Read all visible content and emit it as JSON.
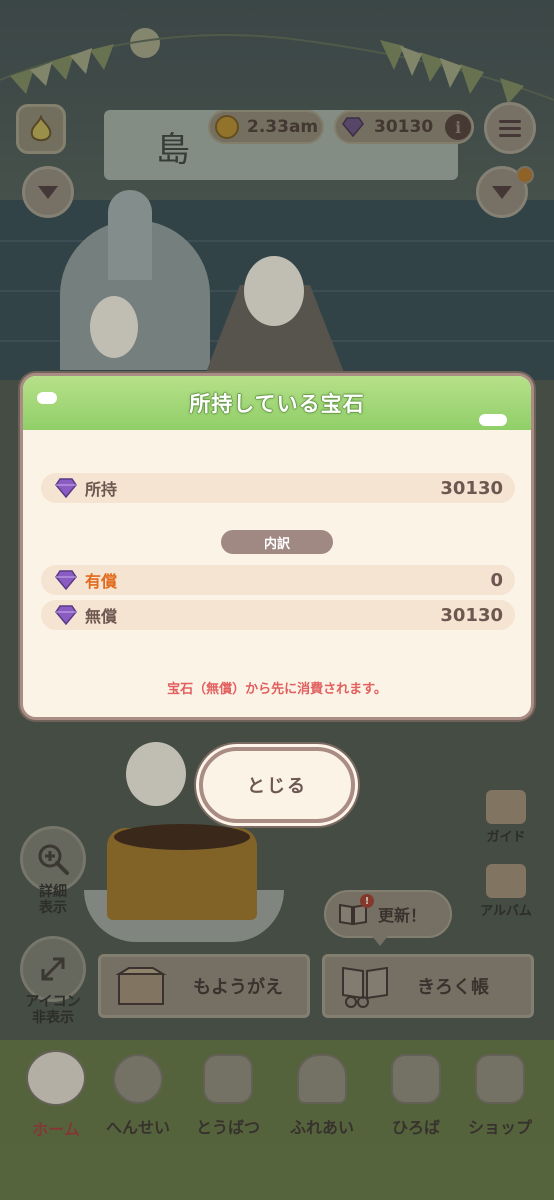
{
  "top_bar": {
    "time_value": "2.33am",
    "gem_count": "30130",
    "info_glyph": "i",
    "banner_text": "島"
  },
  "side": {
    "detail_label_line1": "詳細",
    "detail_label_line2": "表示",
    "icon_toggle_line1": "アイコン",
    "icon_toggle_line2": "非表示"
  },
  "corner": {
    "guide_label": "ガイド",
    "album_label": "アルバム"
  },
  "buttons": {
    "update_label": "更新！",
    "update_alert": "!",
    "moyougae_label": "もようがえ",
    "kiroku_label": "きろく帳"
  },
  "nav": {
    "items": [
      {
        "label": "ホーム",
        "active": true
      },
      {
        "label": "へんせい",
        "active": false
      },
      {
        "label": "とうばつ",
        "active": false
      },
      {
        "label": "ふれあい",
        "active": false
      },
      {
        "label": "ひろば",
        "active": false
      },
      {
        "label": "ショップ",
        "active": false
      }
    ]
  },
  "modal": {
    "title": "所持している宝石",
    "owned_label": "所持",
    "owned_value": "30130",
    "breakdown_label": "内訳",
    "paid_label": "有償",
    "paid_value": "0",
    "free_label": "無償",
    "free_value": "30130",
    "notice": "宝石（無償）から先に消費されます。",
    "close_label": "とじる"
  },
  "colors": {
    "header_green": "#90cf68",
    "paid_orange": "#e26a1c",
    "notice_red": "#e2605f",
    "gem_purple": "#8a5cc2"
  }
}
